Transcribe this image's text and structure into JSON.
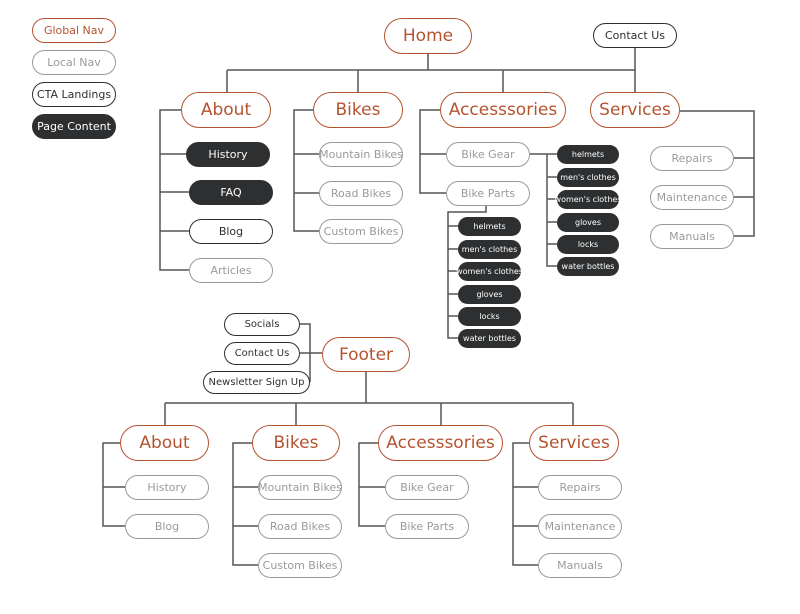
{
  "legend": {
    "global_nav": "Global Nav",
    "local_nav": "Local Nav",
    "cta_landings": "CTA Landings",
    "page_content": "Page Content"
  },
  "colors": {
    "global_nav": "#b5532f",
    "local_nav": "#9a9a9a",
    "cta": "#2d2f31",
    "page_content": "#2d2f31"
  },
  "header": {
    "home": "Home",
    "contact_us": "Contact Us",
    "about": {
      "label": "About",
      "items": [
        "History",
        "FAQ",
        "Blog",
        "Articles"
      ]
    },
    "bikes": {
      "label": "Bikes",
      "items": [
        "Mountain Bikes",
        "Road Bikes",
        "Custom Bikes"
      ]
    },
    "accessories": {
      "label": "Accesssories",
      "bike_gear": "Bike Gear",
      "bike_parts": "Bike Parts",
      "gear_items": [
        "helmets",
        "men's clothes",
        "women's clothes",
        "gloves",
        "locks",
        "water bottles"
      ],
      "parts_items": [
        "helmets",
        "men's clothes",
        "women's clothes",
        "gloves",
        "locks",
        "water bottles"
      ]
    },
    "services": {
      "label": "Services",
      "items": [
        "Repairs",
        "Maintenance",
        "Manuals"
      ]
    }
  },
  "footer": {
    "label": "Footer",
    "links": [
      "Socials",
      "Contact Us",
      "Newsletter Sign Up"
    ],
    "about": {
      "label": "About",
      "items": [
        "History",
        "Blog"
      ]
    },
    "bikes": {
      "label": "Bikes",
      "items": [
        "Mountain Bikes",
        "Road Bikes",
        "Custom Bikes"
      ]
    },
    "accessories": {
      "label": "Accesssories",
      "items": [
        "Bike Gear",
        "Bike Parts"
      ]
    },
    "services": {
      "label": "Services",
      "items": [
        "Repairs",
        "Maintenance",
        "Manuals"
      ]
    }
  }
}
